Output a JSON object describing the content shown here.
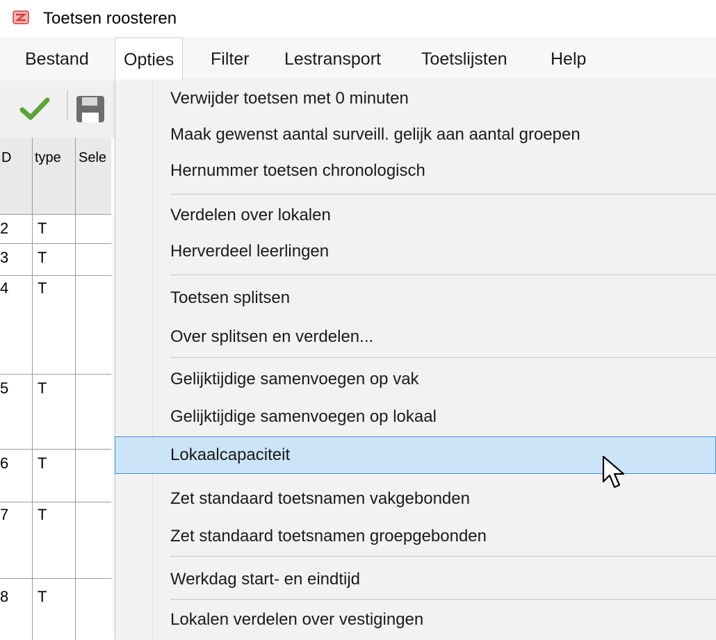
{
  "window": {
    "title": "Toetsen roosteren",
    "icon": "app-icon"
  },
  "menubar": {
    "items": [
      {
        "label": "Bestand"
      },
      {
        "label": "Opties",
        "open": true
      },
      {
        "label": "Filter"
      },
      {
        "label": "Lestransport"
      },
      {
        "label": "Toetslijsten"
      },
      {
        "label": "Help"
      }
    ]
  },
  "toolbar": {
    "icons": [
      "check-icon",
      "save-icon"
    ]
  },
  "grid": {
    "headers": {
      "id": "D",
      "type": "type",
      "sel": "Sele"
    },
    "rows": [
      {
        "id": "2",
        "type": "T"
      },
      {
        "id": "3",
        "type": "T"
      },
      {
        "id": "4",
        "type": "T"
      },
      {
        "id": "5",
        "type": "T"
      },
      {
        "id": "6",
        "type": "T"
      },
      {
        "id": "7",
        "type": "T"
      },
      {
        "id": "8",
        "type": "T"
      }
    ]
  },
  "dropdown": {
    "items": [
      "Verwijder toetsen met 0 minuten",
      "Maak gewenst aantal surveill. gelijk aan aantal groepen",
      "Hernummer toetsen chronologisch",
      "Verdelen over lokalen",
      "Herverdeel leerlingen",
      "Toetsen splitsen",
      "Over splitsen en verdelen...",
      "Gelijktijdige samenvoegen op vak",
      "Gelijktijdige samenvoegen op lokaal",
      "Lokaalcapaciteit",
      "Zet standaard toetsnamen vakgebonden",
      "Zet standaard toetsnamen groepgebonden",
      "Werkdag start- en eindtijd",
      "Lokalen verdelen over vestigingen"
    ],
    "highlighted": "Lokaalcapaciteit",
    "highlight_color": "#cce4f7",
    "highlight_border": "#3d8ee0"
  }
}
